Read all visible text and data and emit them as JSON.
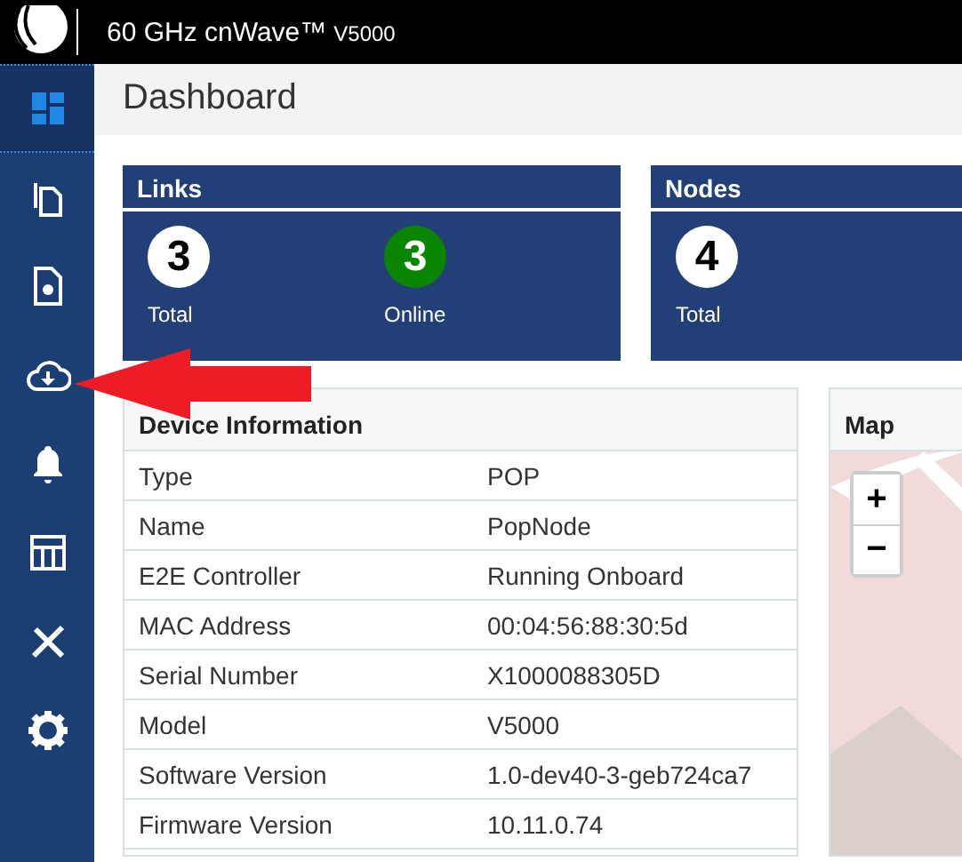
{
  "header": {
    "title": "60 GHz cnWave™",
    "model": "V5000"
  },
  "sidebar": {
    "items": [
      {
        "selected": true
      },
      {
        "selected": false
      },
      {
        "selected": false
      },
      {
        "selected": false
      },
      {
        "selected": false
      },
      {
        "selected": false
      },
      {
        "selected": false
      },
      {
        "selected": false
      }
    ]
  },
  "page_title": "Dashboard",
  "cards": [
    {
      "title": "Links",
      "stats": [
        {
          "value": "3",
          "label": "Total",
          "kind": "total"
        },
        {
          "value": "3",
          "label": "Online",
          "kind": "online"
        }
      ]
    },
    {
      "title": "Nodes",
      "stats": [
        {
          "value": "4",
          "label": "Total",
          "kind": "total"
        }
      ]
    }
  ],
  "device_info": {
    "title": "Device Information",
    "rows": [
      {
        "label": "Type",
        "value": "POP"
      },
      {
        "label": "Name",
        "value": "PopNode"
      },
      {
        "label": "E2E Controller",
        "value": "Running Onboard"
      },
      {
        "label": "MAC Address",
        "value": "00:04:56:88:30:5d"
      },
      {
        "label": "Serial Number",
        "value": "X1000088305D"
      },
      {
        "label": "Model",
        "value": "V5000"
      },
      {
        "label": "Software Version",
        "value": "1.0-dev40-3-geb724ca7"
      },
      {
        "label": "Firmware Version",
        "value": "10.11.0.74"
      }
    ]
  },
  "map": {
    "title": "Map",
    "zoom_in": "+",
    "zoom_out": "−"
  }
}
